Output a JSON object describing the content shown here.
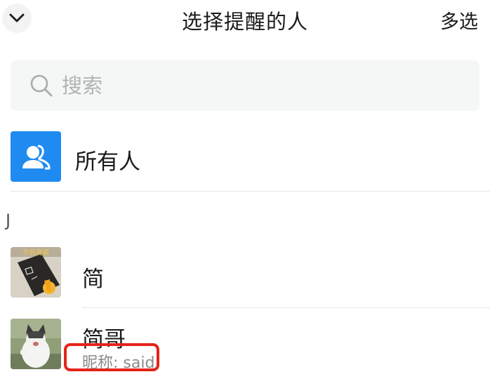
{
  "header": {
    "title": "选择提醒的人",
    "multi_select_label": "多选"
  },
  "search": {
    "placeholder": "搜索",
    "value": ""
  },
  "all_member": {
    "label": "所有人",
    "icon": "group-icon",
    "color": "#1f8bf0"
  },
  "sections": [
    {
      "letter": "J",
      "contacts": [
        {
          "name": "简",
          "avatar_badge": "节后再说"
        },
        {
          "name": "简哥",
          "nickname": "昵称: said"
        }
      ]
    }
  ],
  "colors": {
    "highlight_box": "#e5231a"
  }
}
